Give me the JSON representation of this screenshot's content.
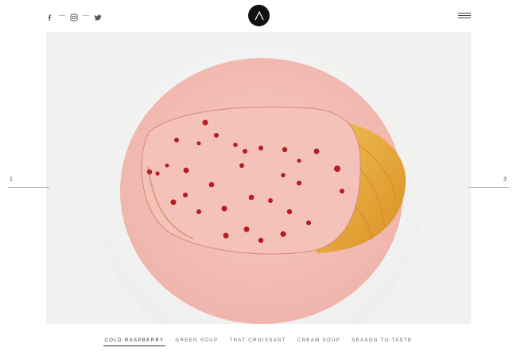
{
  "header": {
    "social": [
      {
        "icon": "facebook-icon"
      },
      {
        "icon": "instagram-icon"
      },
      {
        "icon": "twitter-icon"
      }
    ],
    "logo": "logo-icon",
    "menu": "hamburger-menu-icon"
  },
  "slider": {
    "prev_number": "1",
    "next_number": "3",
    "image": "salmon-with-pink-sauce-on-plate"
  },
  "tabs": [
    {
      "label": "COLD RASPBERRY",
      "active": true
    },
    {
      "label": "GREEN SOUP",
      "active": false
    },
    {
      "label": "THAT CROISSANT",
      "active": false
    },
    {
      "label": "CREAM SOUP",
      "active": false
    },
    {
      "label": "SEASON TO TASTE",
      "active": false
    }
  ],
  "colors": {
    "background": "#ffffff",
    "photo_backdrop": "#f1f1f0",
    "plate": "#fbfbfb",
    "sauce": "#f3bfb6",
    "fish_crust": "#e0a23a",
    "berry": "#b21e23"
  }
}
